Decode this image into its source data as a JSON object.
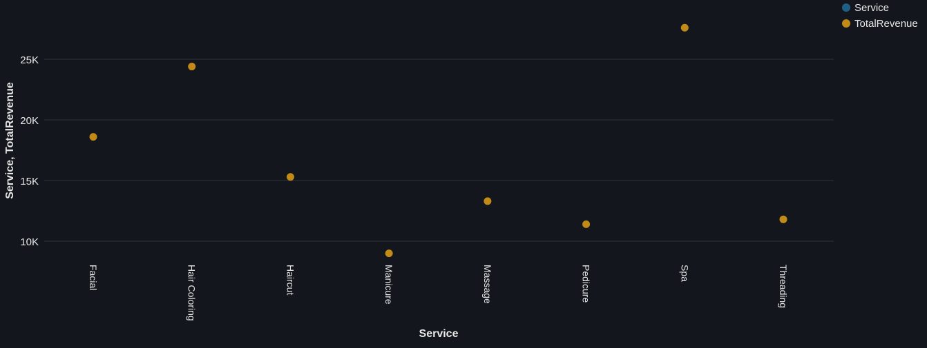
{
  "chart_data": {
    "type": "scatter",
    "title": "",
    "xlabel": "Service",
    "ylabel": "Service, TotalRevenue",
    "categories": [
      "Facial",
      "Hair Coloring",
      "Haircut",
      "Manicure",
      "Massage",
      "Pedicure",
      "Spa",
      "Threading"
    ],
    "y_ticks": [
      10000,
      15000,
      20000,
      25000
    ],
    "y_tick_labels": [
      "10K",
      "15K",
      "20K",
      "25K"
    ],
    "ylim": [
      8300,
      28600
    ],
    "grid": true,
    "legend_position": "top-right",
    "legend": [
      {
        "name": "Service",
        "color": "#1f5f86"
      },
      {
        "name": "TotalRevenue",
        "color": "#c28a16"
      }
    ],
    "series": [
      {
        "name": "TotalRevenue",
        "color": "#c28a16",
        "values": [
          18600,
          24400,
          15300,
          9000,
          13300,
          11400,
          27600,
          11800
        ]
      }
    ],
    "colors": {
      "background": "#13171d",
      "grid": "#2f3338",
      "text": "#e6e6e6"
    }
  }
}
